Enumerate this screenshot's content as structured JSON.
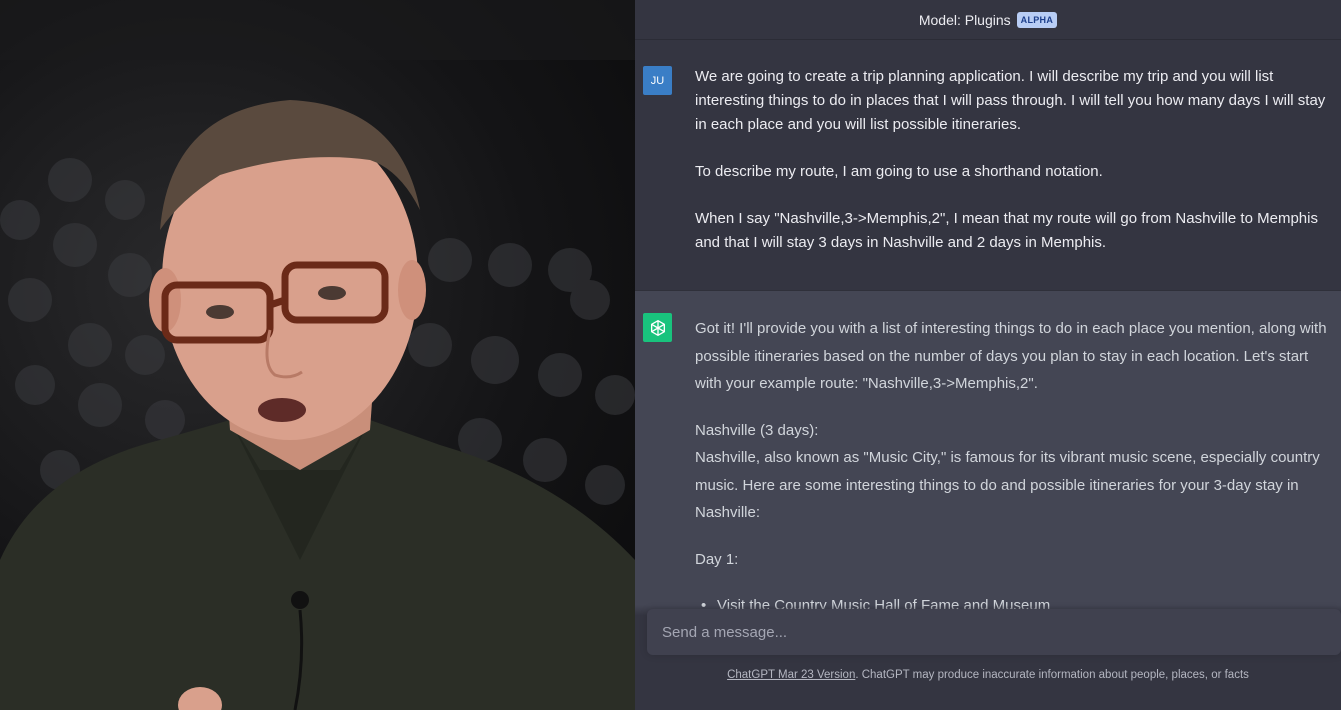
{
  "header": {
    "model_label": "Model: Plugins",
    "model_badge": "ALPHA"
  },
  "user_message": {
    "avatar_initials": "JU",
    "paragraphs": [
      "We are going to create a trip planning application. I will describe my trip and you will list interesting things to do in places that I will pass through. I will tell you how many days I will stay in each place and you will list possible itineraries.",
      "To describe my route, I am going to use a shorthand notation.",
      "When I say \"Nashville,3->Memphis,2\", I mean that my route will go from Nashville to Memphis and that I will stay 3 days in Nashville and 2 days in Memphis."
    ]
  },
  "assistant_message": {
    "avatar_icon": "openai-logo-icon",
    "intro": "Got it! I'll provide you with a list of interesting things to do in each place you mention, along with possible itineraries based on the number of days you plan to stay in each location. Let's start with your example route: \"Nashville,3->Memphis,2\".",
    "section_heading": "Nashville (3 days):",
    "section_body": "Nashville, also known as \"Music City,\" is famous for its vibrant music scene, especially country music. Here are some interesting things to do and possible itineraries for your 3-day stay in Nashville:",
    "day_heading": "Day 1:",
    "bullet": "Visit the Country Music Hall of Fame and Museum"
  },
  "composer": {
    "placeholder": "Send a message..."
  },
  "footer": {
    "version_link": "ChatGPT Mar 23 Version",
    "disclaimer": ". ChatGPT may produce inaccurate information about people, places, or facts"
  },
  "colors": {
    "panel_bg": "#343541",
    "assistant_bg": "#444654",
    "assistant_avatar": "#19c37d",
    "user_avatar": "#3a7ec6",
    "badge_bg": "#b8cdf5"
  }
}
